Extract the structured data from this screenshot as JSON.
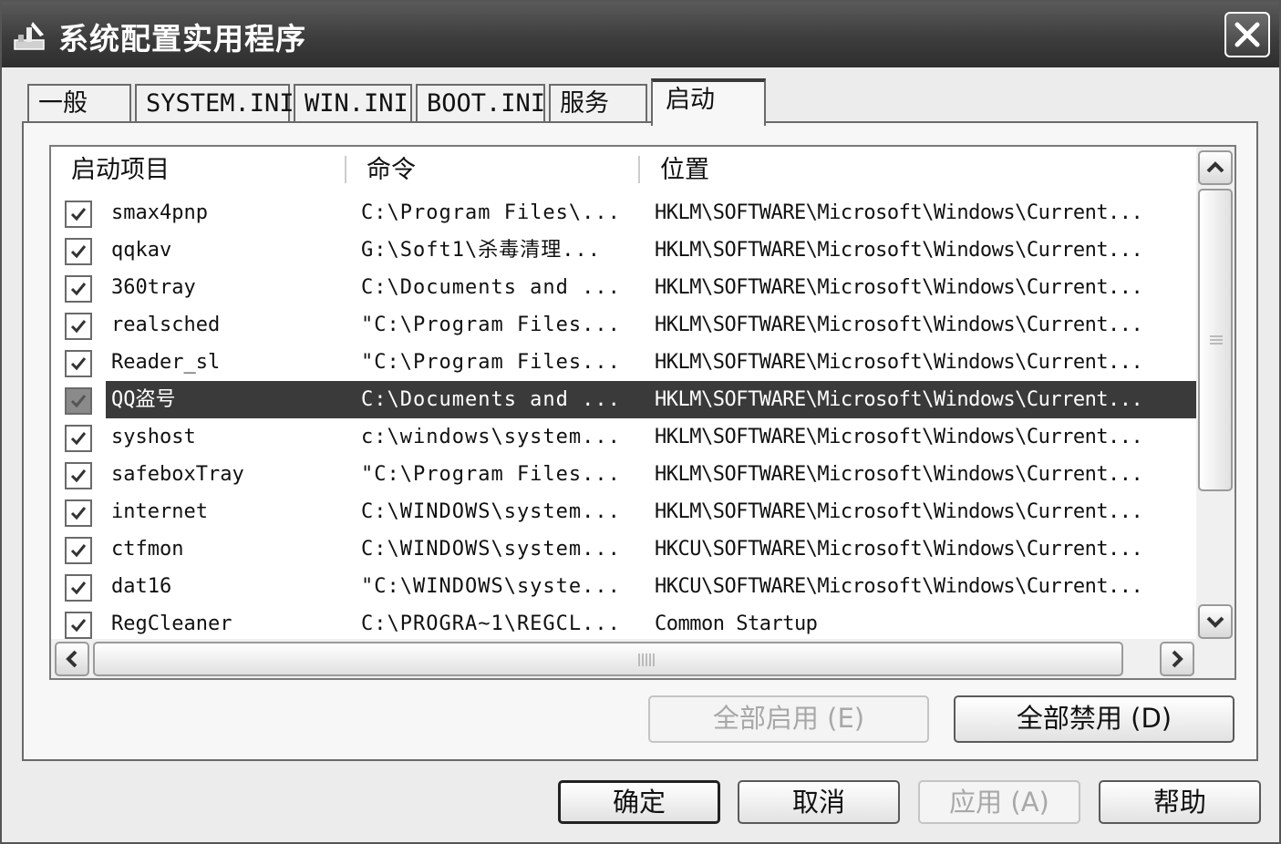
{
  "window": {
    "title": "系统配置实用程序"
  },
  "tabs": [
    {
      "label": "一般"
    },
    {
      "label": "SYSTEM.INI"
    },
    {
      "label": "WIN.INI"
    },
    {
      "label": "BOOT.INI"
    },
    {
      "label": "服务"
    },
    {
      "label": "启动"
    }
  ],
  "active_tab": "启动",
  "list": {
    "columns": [
      "启动项目",
      "命令",
      "位置"
    ],
    "rows": [
      {
        "checked": true,
        "name": "smax4pnp",
        "command": "C:\\Program Files\\...",
        "location": "HKLM\\SOFTWARE\\Microsoft\\Windows\\Current..."
      },
      {
        "checked": true,
        "name": "qqkav",
        "command": "G:\\Soft1\\杀毒清理...",
        "location": "HKLM\\SOFTWARE\\Microsoft\\Windows\\Current..."
      },
      {
        "checked": true,
        "name": "360tray",
        "command": "C:\\Documents and ...",
        "location": "HKLM\\SOFTWARE\\Microsoft\\Windows\\Current..."
      },
      {
        "checked": true,
        "name": "realsched",
        "command": "\"C:\\Program Files...",
        "location": "HKLM\\SOFTWARE\\Microsoft\\Windows\\Current..."
      },
      {
        "checked": true,
        "name": "Reader_sl",
        "command": "\"C:\\Program Files...",
        "location": "HKLM\\SOFTWARE\\Microsoft\\Windows\\Current..."
      },
      {
        "checked": true,
        "name": "QQ盗号",
        "command": "C:\\Documents and ...",
        "location": "HKLM\\SOFTWARE\\Microsoft\\Windows\\Current...",
        "selected": true
      },
      {
        "checked": true,
        "name": "syshost",
        "command": "c:\\windows\\system...",
        "location": "HKLM\\SOFTWARE\\Microsoft\\Windows\\Current..."
      },
      {
        "checked": true,
        "name": "safeboxTray",
        "command": "\"C:\\Program Files...",
        "location": "HKLM\\SOFTWARE\\Microsoft\\Windows\\Current..."
      },
      {
        "checked": true,
        "name": "internet",
        "command": "C:\\WINDOWS\\system...",
        "location": "HKLM\\SOFTWARE\\Microsoft\\Windows\\Current..."
      },
      {
        "checked": true,
        "name": "ctfmon",
        "command": "C:\\WINDOWS\\system...",
        "location": "HKCU\\SOFTWARE\\Microsoft\\Windows\\Current..."
      },
      {
        "checked": true,
        "name": "dat16",
        "command": "\"C:\\WINDOWS\\syste...",
        "location": "HKCU\\SOFTWARE\\Microsoft\\Windows\\Current..."
      },
      {
        "checked": true,
        "name": "RegCleaner",
        "command": "C:\\PROGRA~1\\REGCL...",
        "location": "Common Startup"
      }
    ]
  },
  "buttons": {
    "enable_all": "全部启用 (E)",
    "disable_all": "全部禁用 (D)",
    "ok": "确定",
    "cancel": "取消",
    "apply": "应用 (A)",
    "help": "帮助"
  },
  "icons": {
    "title": "msconfig-icon",
    "close": "close-icon",
    "scroll_up": "chevron-up-icon",
    "scroll_down": "chevron-down-icon",
    "scroll_left": "chevron-left-icon",
    "scroll_right": "chevron-right-icon"
  },
  "colors": {
    "titlebar": "#3d3d3d",
    "selection": "#3a3a3a",
    "window_bg": "#ececec"
  }
}
